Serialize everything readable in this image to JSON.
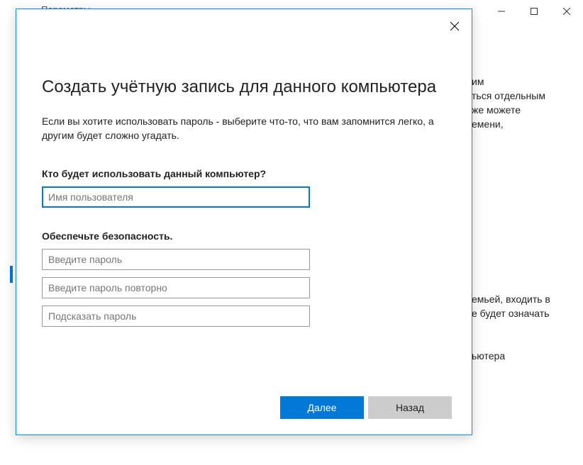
{
  "header": {
    "back_glyph": "←",
    "title": "Параметры"
  },
  "background": {
    "frag1": "им\nться отдельным\nже можете\nемени,",
    "frag2": "емьей, входить в\nе будет означать",
    "frag3": "ьютера"
  },
  "dialog": {
    "title": "Создать учётную запись для данного компьютера",
    "description": "Если вы хотите использовать пароль - выберите что-то, что вам запомнится легко, а другим будет сложно угадать.",
    "section1_label": "Кто будет использовать данный компьютер?",
    "username_placeholder": "Имя пользователя",
    "section2_label": "Обеспечьте безопасность.",
    "password_placeholder": "Введите пароль",
    "password2_placeholder": "Введите пароль повторно",
    "hint_placeholder": "Подсказать пароль",
    "btn_next": "Далее",
    "btn_back": "Назад"
  }
}
